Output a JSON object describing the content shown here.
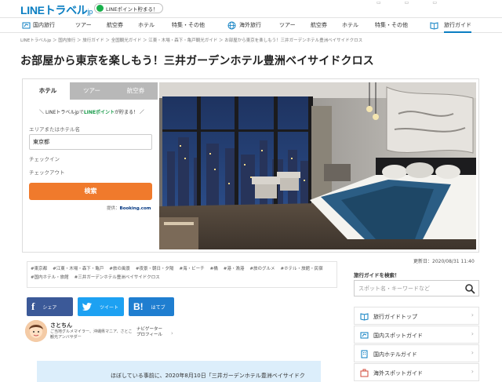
{
  "header": {
    "logo_main": "LINEトラベル",
    "logo_suffix": "jp",
    "point_text": "LINEポイント貯まる！"
  },
  "nav": {
    "domestic": [
      "国内旅行",
      "ツアー",
      "航空券",
      "ホテル",
      "特集・その他"
    ],
    "overseas": [
      "海外旅行",
      "ツアー",
      "航空券",
      "ホテル",
      "特集・その他"
    ],
    "guide": "旅行ガイド"
  },
  "breadcrumb": "LINEトラベルjp ＞ 国内旅行 ＞ 旅行ガイド ＞ 全国観光ガイド ＞ 江東・木場・森下・亀戸観光ガイド ＞ お部屋から東京を楽しもう！三井ガーデンホテル豊洲ベイサイドクロス",
  "title": "お部屋から東京を楽しもう！三井ガーデンホテル豊洲ベイサイドクロス",
  "search": {
    "tabs": [
      "ホテル",
      "ツアー",
      "航空券"
    ],
    "promo_prefix": "＼ LINEトラベルjpで",
    "promo_highlight": "LINEポイント",
    "promo_suffix": "が貯まる！ ／",
    "area_label": "エリアまたはホテル名",
    "area_value": "東京都",
    "checkin_label": "チェックイン",
    "checkout_label": "チェックアウト",
    "button": "検索",
    "provider_prefix": "提供：",
    "provider_name": "Booking.com"
  },
  "updated": "更新日：2020/08/31 11:40",
  "tags": [
    "東京都",
    "江東・木場・森下・亀戸",
    "旅の風景",
    "夜景・朝日・夕陽",
    "海・ビーチ",
    "橋",
    "港・漁港",
    "旅のグルメ",
    "ホテル・旅館・民宿",
    "国内ホテル・旅館",
    "三井ガーデンホテル豊洲ベイサイドクロス"
  ],
  "share": {
    "facebook": "シェア",
    "twitter": "ツイート",
    "hatena": "はてブ"
  },
  "author": {
    "name": "さとちん",
    "bio": "ご当地グルメマイラー、沖縄県マニア、さとこ観光アンバサダー",
    "navigator_line1": "ナビゲーター",
    "navigator_line2": "プロフィール"
  },
  "intro": "ほぼしている事前に、2020年8月10日「三井ガーデンホテル豊洲ベイサイドク",
  "sidebar": {
    "heading": "旅行ガイドを検索！",
    "search_placeholder": "スポット名・キーワードなど",
    "items": [
      "旅行ガイドトップ",
      "国内スポットガイド",
      "国内ホテルガイド",
      "海外スポットガイド"
    ]
  },
  "colors": {
    "brand_blue": "#0a7ec2",
    "search_orange": "#f07a2c",
    "line_green": "#19b14c",
    "facebook": "#3b5998",
    "twitter": "#1da1f2",
    "hatena": "#1f7ed0"
  }
}
